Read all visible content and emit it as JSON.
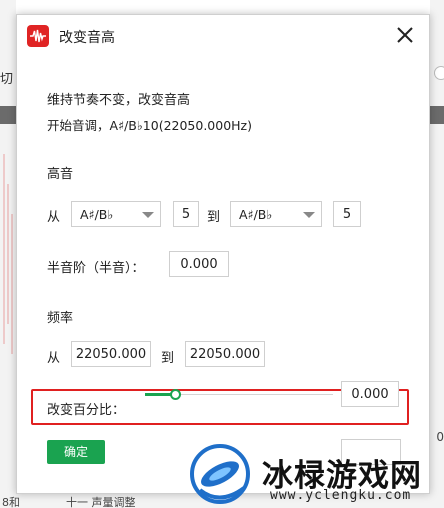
{
  "background": {
    "left_label": "切",
    "right_label": "0",
    "bottom_labels": [
      "8和",
      "十一 声量调整"
    ]
  },
  "dialog": {
    "title": "改变音高",
    "info_line1": "维持节奏不变，改变音高",
    "info_line2": "开始音调，A♯/B♭10(22050.000Hz)"
  },
  "pitch": {
    "section_label": "高音",
    "from_label": "从",
    "from_note": "A♯/B♭",
    "from_octave": "5",
    "to_label": "到",
    "to_note": "A♯/B♭",
    "to_octave": "5"
  },
  "semitone": {
    "label": "半音阶（半音）：",
    "value": "0.000"
  },
  "frequency": {
    "section_label": "频率",
    "from_label": "从",
    "from_value": "22050.000",
    "to_label": "到",
    "to_value": "22050.000"
  },
  "percent_change": {
    "label": "改变百分比：",
    "value": "0.000",
    "slider_fraction": 0.16
  },
  "buttons": {
    "ok_label": "确定"
  },
  "watermark": {
    "text": "冰椂游戏网",
    "url": "www.yclengku.com"
  },
  "colors": {
    "accent_green": "#1aa350",
    "highlight_red": "#e02020",
    "app_logo_red": "#e02424"
  }
}
